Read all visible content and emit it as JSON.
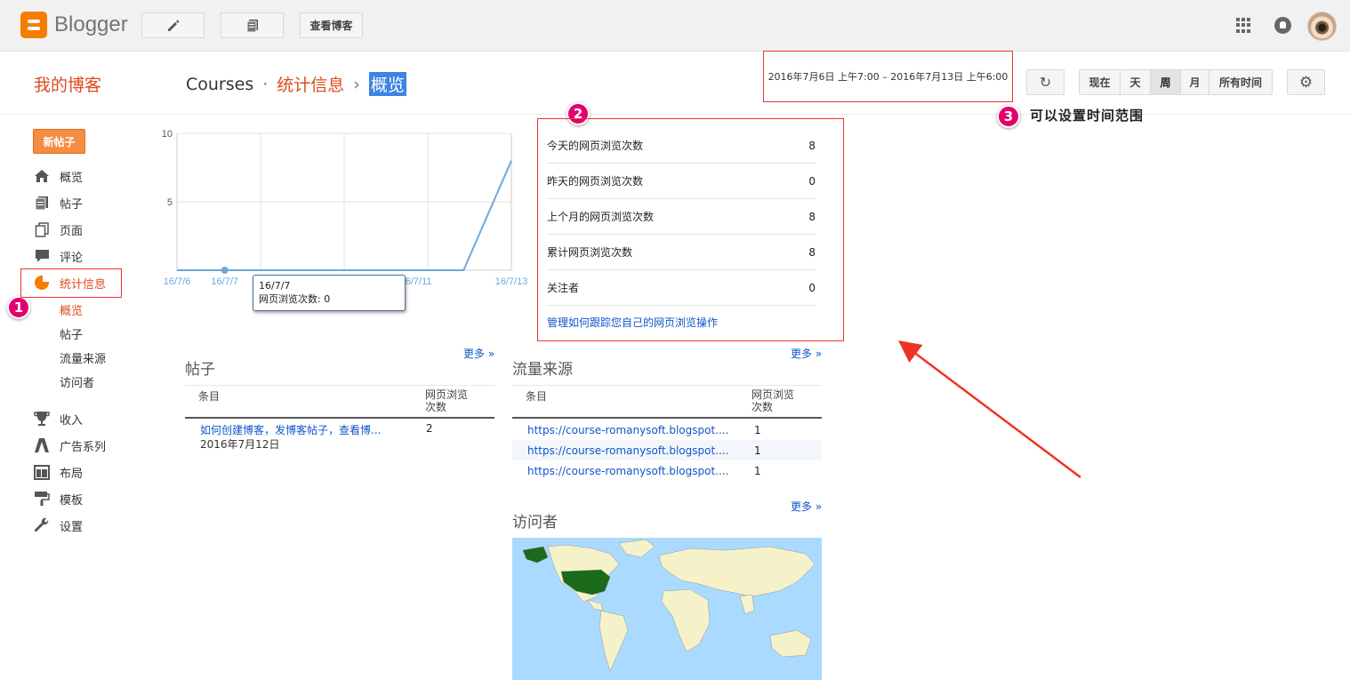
{
  "topbar": {
    "logo_text": "Blogger",
    "view_blog_label": "查看博客"
  },
  "header": {
    "blog_name": "我的博客",
    "breadcrumb": [
      "Courses",
      "统计信息",
      "概览"
    ],
    "date_range": "2016年7月6日 上午7:00 – 2016年7月13日 上午6:00",
    "range_buttons": [
      "现在",
      "天",
      "周",
      "月",
      "所有时间"
    ],
    "active_range": "周"
  },
  "annotations": {
    "badge1": "1",
    "badge2": "2",
    "badge3": "3",
    "note3": "可以设置时间范围"
  },
  "sidebar": {
    "new_post": "新帖子",
    "items": [
      {
        "label": "概览",
        "icon": "home-icon"
      },
      {
        "label": "帖子",
        "icon": "posts-icon"
      },
      {
        "label": "页面",
        "icon": "pages-icon"
      },
      {
        "label": "评论",
        "icon": "comment-icon"
      },
      {
        "label": "统计信息",
        "icon": "pie-chart-icon"
      }
    ],
    "sub_items": [
      "概览",
      "帖子",
      "流量来源",
      "访问者"
    ],
    "items2": [
      {
        "label": "收入",
        "icon": "trophy-icon"
      },
      {
        "label": "广告系列",
        "icon": "campaign-icon"
      },
      {
        "label": "布局",
        "icon": "layout-icon"
      },
      {
        "label": "模板",
        "icon": "paint-roller-icon"
      },
      {
        "label": "设置",
        "icon": "wrench-icon"
      }
    ]
  },
  "chart_data": {
    "type": "line",
    "x": [
      "16/7/6",
      "16/7/7",
      "16/7/8",
      "16/7/9",
      "16/7/10",
      "16/7/11",
      "16/7/12",
      "16/7/13"
    ],
    "x_tick_labels": [
      "16/7/6",
      "16/7/7",
      "16/7/9",
      "16/7/11",
      "16/7/13"
    ],
    "series": [
      {
        "values": [
          0,
          0,
          0,
          0,
          0,
          0,
          0,
          8
        ]
      }
    ],
    "yticks": [
      10,
      5
    ],
    "ylim": [
      0,
      10
    ],
    "grid": true,
    "color": "#6fa8dc",
    "tooltip": {
      "date": "16/7/7",
      "label": "网页浏览次数",
      "value": "0"
    }
  },
  "stats": {
    "rows": [
      {
        "label": "今天的网页浏览次数",
        "value": "8"
      },
      {
        "label": "昨天的网页浏览次数",
        "value": "0"
      },
      {
        "label": "上个月的网页浏览次数",
        "value": "8"
      },
      {
        "label": "累计网页浏览次数",
        "value": "8"
      },
      {
        "label": "关注者",
        "value": "0"
      }
    ],
    "link": "管理如何跟踪您自己的网页浏览操作"
  },
  "posts_panel": {
    "title": "帖子",
    "more": "更多 »",
    "col1": "条目",
    "col2a": "网页浏览",
    "col2b": "次数",
    "rows": [
      {
        "title": "如何创建博客，发博客帖子，查看博...",
        "date": "2016年7月12日",
        "views": "2"
      }
    ]
  },
  "traffic_panel": {
    "title": "流量来源",
    "more": "更多 »",
    "col1": "条目",
    "col2a": "网页浏览",
    "col2b": "次数",
    "rows": [
      {
        "url": "https://course-romanysoft.blogspot....",
        "views": "1"
      },
      {
        "url": "https://course-romanysoft.blogspot....",
        "views": "1"
      },
      {
        "url": "https://course-romanysoft.blogspot....",
        "views": "1"
      }
    ]
  },
  "visitors_panel": {
    "title": "访问者",
    "more": "更多 »"
  }
}
